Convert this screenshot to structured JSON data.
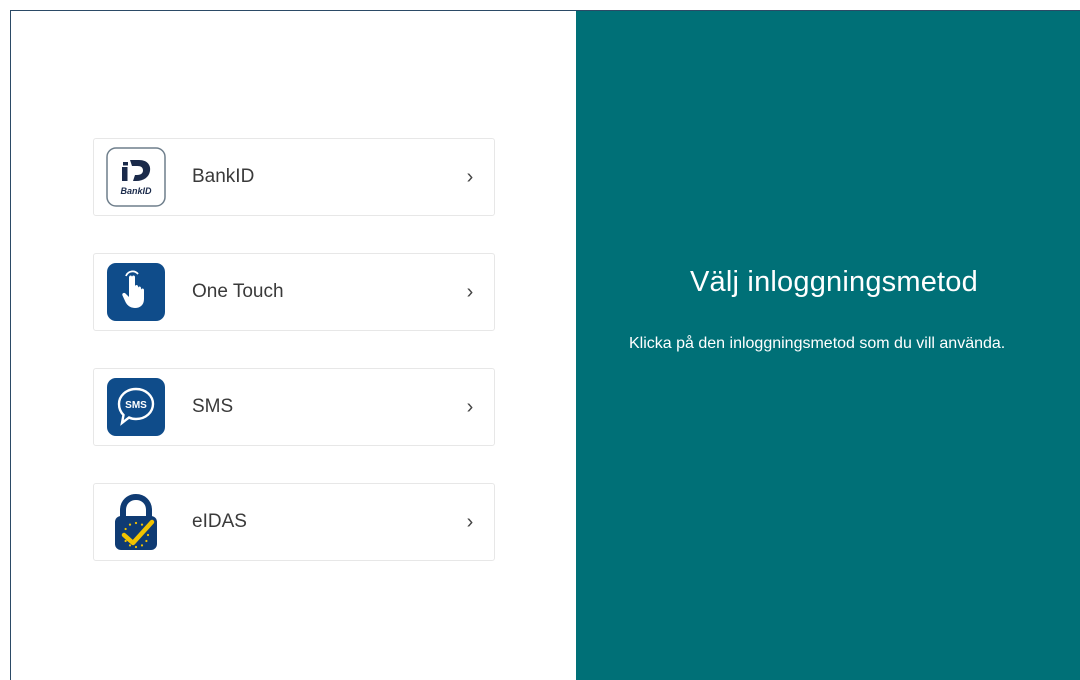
{
  "login": {
    "methods": [
      {
        "label": "BankID",
        "icon": "bankid-icon"
      },
      {
        "label": "One Touch",
        "icon": "one-touch-icon"
      },
      {
        "label": "SMS",
        "icon": "sms-icon"
      },
      {
        "label": "eIDAS",
        "icon": "eidas-icon"
      }
    ],
    "chevron": "›"
  },
  "info": {
    "title": "Välj inloggningsmetod",
    "description": "Klicka på den inloggningsmetod som du vill använda."
  },
  "icon_text": {
    "bankid_logo_text": "BankID",
    "sms_bubble_text": "SMS"
  },
  "colors": {
    "panel_teal": "#007077",
    "icon_blue": "#0f4c8a",
    "eidas_yellow": "#f2c300"
  }
}
